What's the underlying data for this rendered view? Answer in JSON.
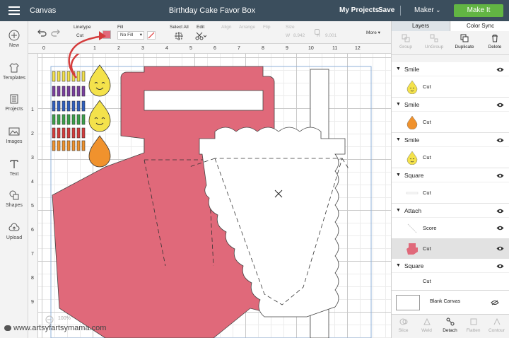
{
  "topbar": {
    "app_title": "Canvas",
    "document_title": "Birthday Cake Favor Box",
    "my_projects": "My Projects",
    "save": "Save",
    "machine": "Maker",
    "make_it": "Make It"
  },
  "toolbar": {
    "undo_icon": "undo-icon",
    "redo_icon": "redo-icon",
    "linetype_label": "Linetype",
    "linetype_value": "Cut",
    "fill_label": "Fill",
    "fill_value": "No Fill",
    "select_all": "Select All",
    "edit": "Edit",
    "align": "Align",
    "arrange": "Arrange",
    "flip": "Flip",
    "size": "Size",
    "size_w_label": "W",
    "size_w_value": "8.942",
    "size_h_label": "H",
    "size_h_value": "9.001",
    "more": "More",
    "color_swatch": "#e16a7b"
  },
  "sidebar": {
    "items": [
      {
        "label": "New",
        "icon": "plus-icon"
      },
      {
        "label": "Templates",
        "icon": "shirt-icon"
      },
      {
        "label": "Projects",
        "icon": "projects-icon"
      },
      {
        "label": "Images",
        "icon": "image-icon"
      },
      {
        "label": "Text",
        "icon": "text-icon"
      },
      {
        "label": "Shapes",
        "icon": "shapes-icon"
      },
      {
        "label": "Upload",
        "icon": "upload-icon"
      }
    ]
  },
  "ruler": {
    "top": [
      "0",
      "1",
      "2",
      "3",
      "4",
      "5",
      "6",
      "7",
      "8",
      "9",
      "10",
      "11",
      "12"
    ],
    "left": [
      "1",
      "2",
      "3",
      "4",
      "5",
      "6",
      "7",
      "8",
      "9"
    ]
  },
  "canvas": {
    "zoom": "100%",
    "colors": {
      "pink": "#e0697a",
      "orange": "#f0922d",
      "yellow": "#f4e24b",
      "purple": "#7b3fa0",
      "blue": "#2f5fc0",
      "green": "#3aa14a",
      "red": "#d43c3c"
    }
  },
  "panel": {
    "tabs": [
      "Layers",
      "Color Sync"
    ],
    "actions": [
      {
        "label": "Group",
        "enabled": false
      },
      {
        "label": "UnGroup",
        "enabled": false
      },
      {
        "label": "Duplicate",
        "enabled": true
      },
      {
        "label": "Delete",
        "enabled": true
      }
    ],
    "groups": [
      {
        "name": "Smile",
        "child": "Cut"
      },
      {
        "name": "Smile",
        "child": "Cut"
      },
      {
        "name": "Smile",
        "child": "Cut"
      },
      {
        "name": "Square",
        "child": "Cut"
      },
      {
        "name": "Attach",
        "children": [
          "Score",
          "Cut"
        ]
      },
      {
        "name": "Square",
        "child": "Cut"
      }
    ],
    "blank_canvas": "Blank Canvas",
    "bottom_tools": [
      "Slice",
      "Weld",
      "Detach",
      "Flatten",
      "Contour"
    ]
  },
  "watermark": "www.artsyfartsymama.com"
}
